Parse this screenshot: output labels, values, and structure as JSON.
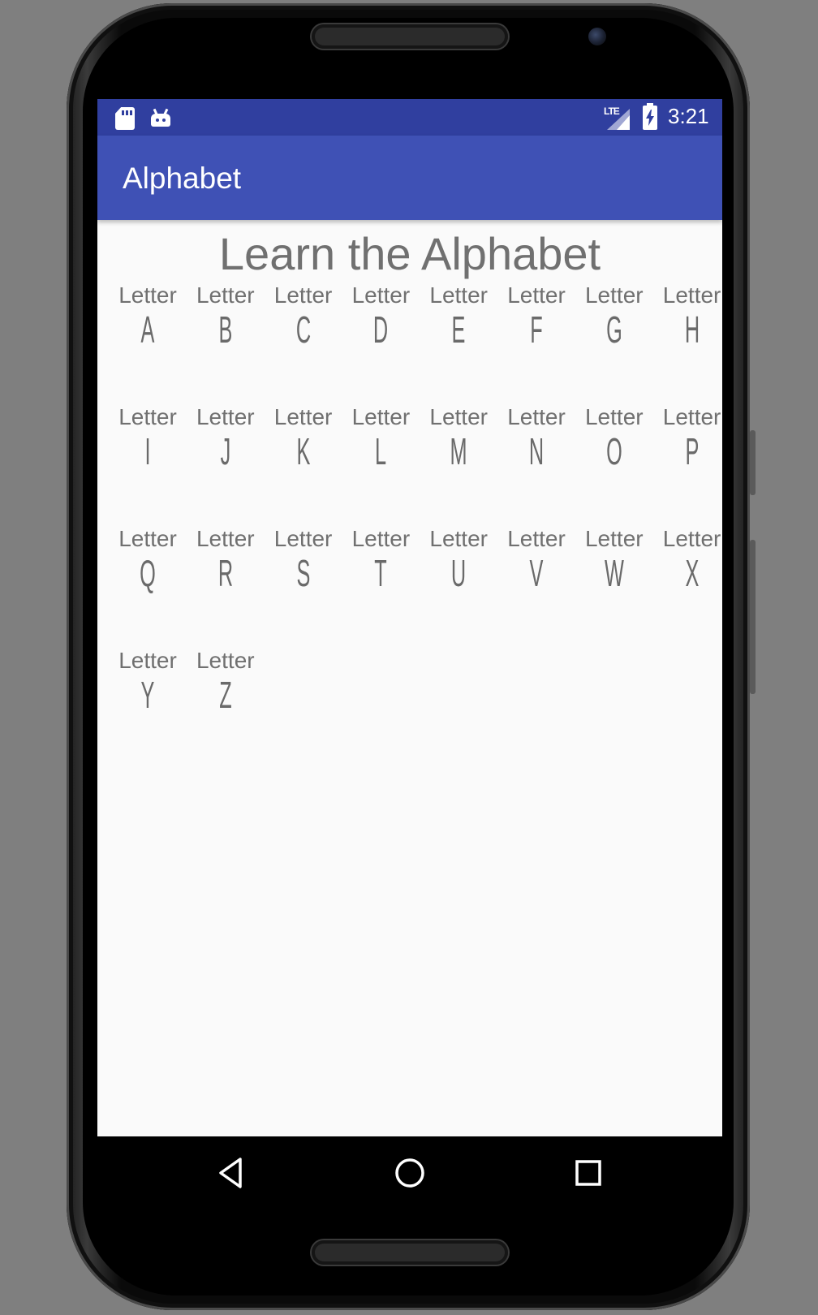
{
  "status_bar": {
    "network": "LTE",
    "time": "3:21",
    "icons": [
      "sd-card-icon",
      "android-icon",
      "signal-icon",
      "battery-charging-icon"
    ]
  },
  "app_bar": {
    "title": "Alphabet"
  },
  "main": {
    "heading": "Learn the Alphabet",
    "cards": [
      {
        "label": "Letter",
        "letter": "A"
      },
      {
        "label": "Letter",
        "letter": "B"
      },
      {
        "label": "Letter",
        "letter": "C"
      },
      {
        "label": "Letter",
        "letter": "D"
      },
      {
        "label": "Letter",
        "letter": "E"
      },
      {
        "label": "Letter",
        "letter": "F"
      },
      {
        "label": "Letter",
        "letter": "G"
      },
      {
        "label": "Letter",
        "letter": "H"
      },
      {
        "label": "Letter",
        "letter": "I"
      },
      {
        "label": "Letter",
        "letter": "J"
      },
      {
        "label": "Letter",
        "letter": "K"
      },
      {
        "label": "Letter",
        "letter": "L"
      },
      {
        "label": "Letter",
        "letter": "M"
      },
      {
        "label": "Letter",
        "letter": "N"
      },
      {
        "label": "Letter",
        "letter": "O"
      },
      {
        "label": "Letter",
        "letter": "P"
      },
      {
        "label": "Letter",
        "letter": "Q"
      },
      {
        "label": "Letter",
        "letter": "R"
      },
      {
        "label": "Letter",
        "letter": "S"
      },
      {
        "label": "Letter",
        "letter": "T"
      },
      {
        "label": "Letter",
        "letter": "U"
      },
      {
        "label": "Letter",
        "letter": "V"
      },
      {
        "label": "Letter",
        "letter": "W"
      },
      {
        "label": "Letter",
        "letter": "X"
      },
      {
        "label": "Letter",
        "letter": "Y"
      },
      {
        "label": "Letter",
        "letter": "Z"
      }
    ]
  },
  "nav_bar": {
    "buttons": [
      "back-icon",
      "home-icon",
      "recents-icon"
    ]
  },
  "colors": {
    "status_bar": "#303f9f",
    "app_bar": "#3f51b5",
    "text": "#707070",
    "background": "#fafafa"
  }
}
